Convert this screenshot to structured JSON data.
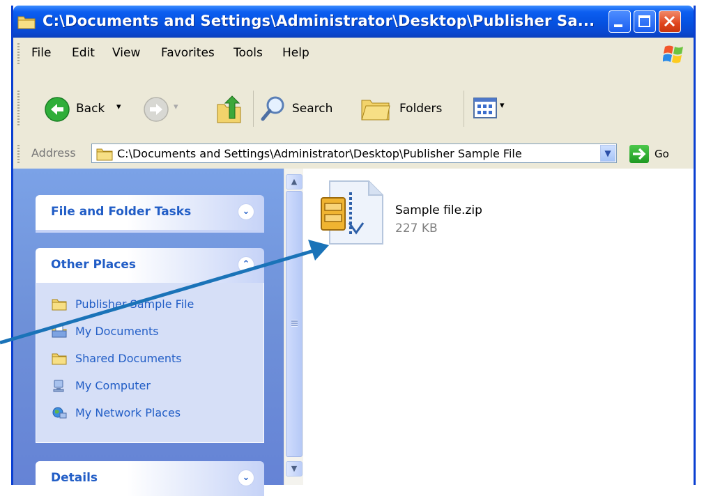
{
  "window": {
    "title": "C:\\Documents and Settings\\Administrator\\Desktop\\Publisher Sa..."
  },
  "menu": [
    "File",
    "Edit",
    "View",
    "Favorites",
    "Tools",
    "Help"
  ],
  "toolbar": {
    "back_label": "Back",
    "search_label": "Search",
    "folders_label": "Folders"
  },
  "address": {
    "label": "Address",
    "value": "C:\\Documents and Settings\\Administrator\\Desktop\\Publisher Sample File",
    "go_label": "Go"
  },
  "tasks": {
    "file_folder_tasks": "File and Folder Tasks",
    "other_places": "Other Places",
    "details": "Details",
    "places": [
      {
        "label": "Publisher Sample File",
        "icon": "folder-icon"
      },
      {
        "label": "My Documents",
        "icon": "my-documents-icon"
      },
      {
        "label": "Shared Documents",
        "icon": "folder-icon"
      },
      {
        "label": "My Computer",
        "icon": "my-computer-icon"
      },
      {
        "label": "My Network Places",
        "icon": "network-places-icon"
      }
    ]
  },
  "files": [
    {
      "name": "Sample file.zip",
      "size": "227 KB",
      "icon": "zip-file-icon"
    }
  ],
  "colors": {
    "titlebar": "#0551e0",
    "task_pane": "#6e90d8",
    "task_link": "#215dc6",
    "annotation_arrow": "#1a73b8"
  }
}
